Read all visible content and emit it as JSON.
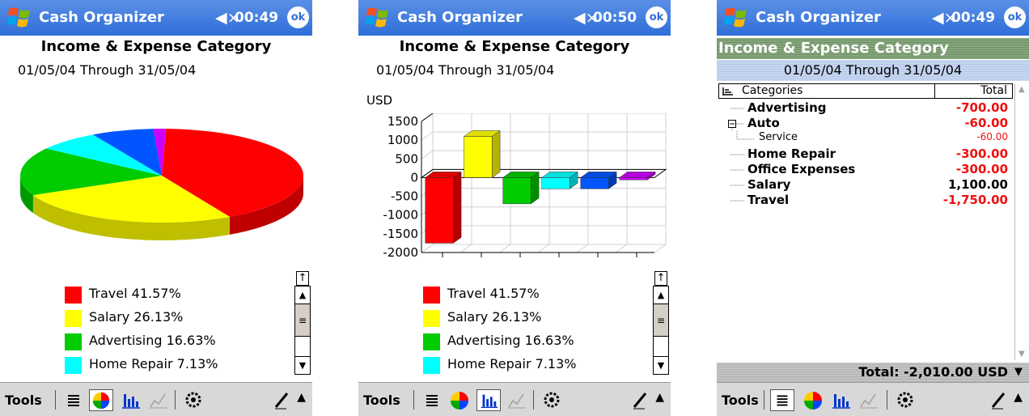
{
  "app": {
    "title": "Cash Organizer",
    "ok_label": "ok",
    "report_title": "Income & Expense Category",
    "date_range": "01/05/04 Through 31/05/04",
    "speaker_icon": "speaker-muted-icon"
  },
  "screens": [
    {
      "time": "00:49",
      "view": "pie"
    },
    {
      "time": "00:50",
      "view": "bar"
    },
    {
      "time": "00:49",
      "view": "table"
    }
  ],
  "legend": [
    {
      "label": "Travel 41.57%",
      "color": "#ff0000"
    },
    {
      "label": "Salary 26.13%",
      "color": "#ffff00"
    },
    {
      "label": "Advertising 16.63%",
      "color": "#00cc00"
    },
    {
      "label": "Home Repair 7.13%",
      "color": "#00ffff"
    }
  ],
  "toolbar": {
    "tools_label": "Tools",
    "icons": [
      "list-view-icon",
      "pie-chart-icon",
      "bar-chart-icon",
      "line-chart-icon",
      "settings-icon",
      "pen-icon"
    ]
  },
  "table": {
    "col_category": "Categories",
    "col_total": "Total",
    "rows": [
      {
        "label": "Advertising",
        "value": "-700.00",
        "level": 0
      },
      {
        "label": "Auto",
        "value": "-60.00",
        "level": 0,
        "expanded": true
      },
      {
        "label": "Service",
        "value": "-60.00",
        "level": 1
      },
      {
        "label": "Home Repair",
        "value": "-300.00",
        "level": 0
      },
      {
        "label": "Office Expenses",
        "value": "-300.00",
        "level": 0
      },
      {
        "label": "Salary",
        "value": "1,100.00",
        "level": 0
      },
      {
        "label": "Travel",
        "value": "-1,750.00",
        "level": 0
      }
    ],
    "total": "Total: -2,010.00 USD"
  },
  "chart_data": [
    {
      "type": "pie",
      "categories": [
        "Travel",
        "Salary",
        "Advertising",
        "Home Repair",
        "Office Expenses",
        "Auto"
      ],
      "values": [
        41.57,
        26.13,
        16.63,
        7.13,
        7.13,
        1.43
      ],
      "colors": [
        "#ff0000",
        "#ffff00",
        "#00cc00",
        "#00ffff",
        "#0055ff",
        "#cc00ff"
      ],
      "3d": true
    },
    {
      "type": "bar",
      "title": "",
      "ylabel": "USD",
      "categories": [
        "Travel",
        "Salary",
        "Advertising",
        "Home Repair",
        "Office Expenses",
        "Auto"
      ],
      "values": [
        -1750,
        1100,
        -700,
        -300,
        -300,
        -60
      ],
      "colors": [
        "#ff0000",
        "#ffff00",
        "#00cc00",
        "#00ffff",
        "#0055ff",
        "#cc00ff"
      ],
      "yticks": [
        1500,
        1000,
        500,
        0,
        -500,
        -1000,
        -1500,
        -2000
      ],
      "ylim": [
        -2000,
        1500
      ],
      "grid": true,
      "3d": true
    }
  ]
}
